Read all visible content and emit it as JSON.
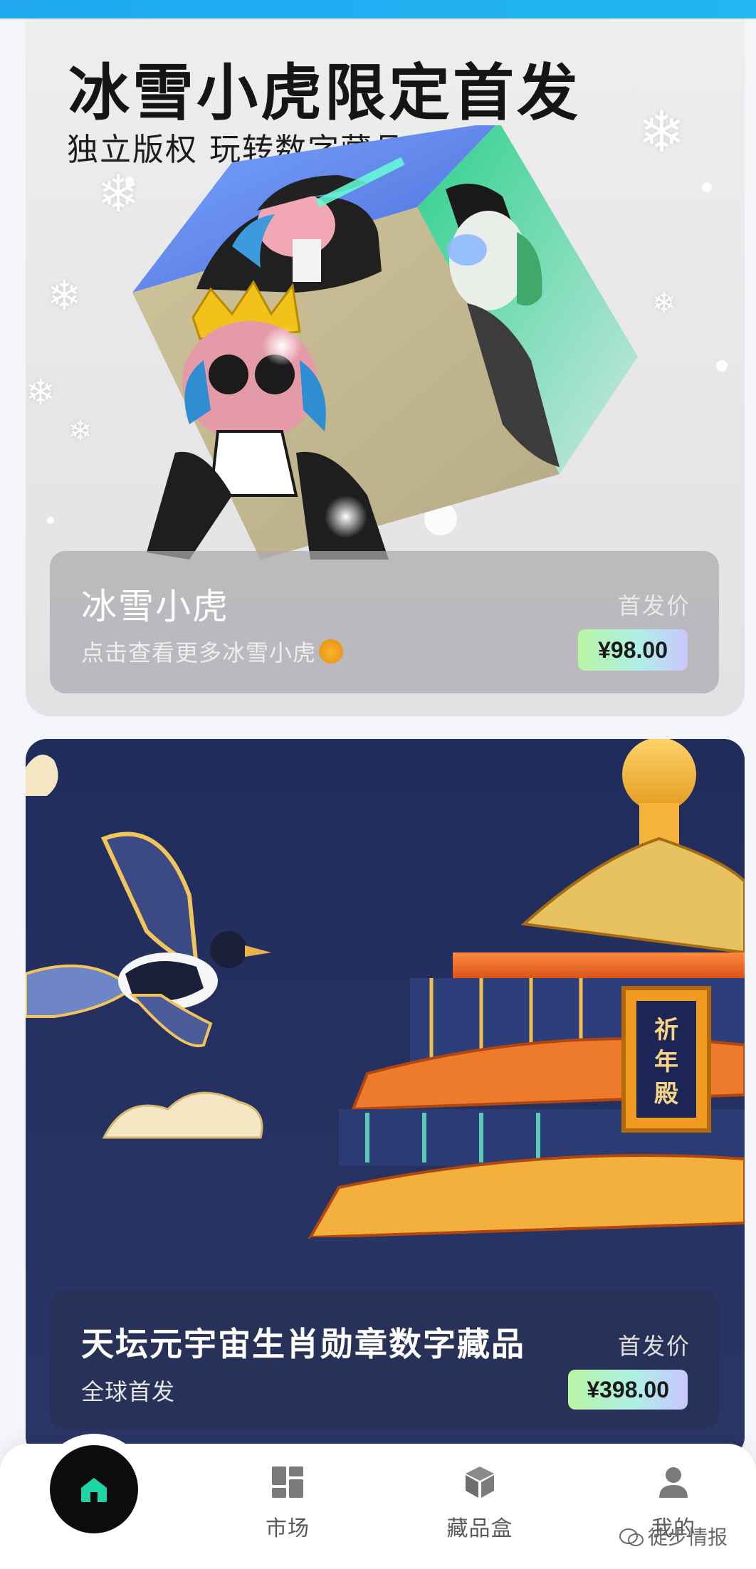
{
  "colors": {
    "status_strip": "#1fa8ee",
    "price_tag_gradient": [
      "#b9f5a4",
      "#aef0e6",
      "#c9c6ff"
    ],
    "home_button": "#0c0c0c",
    "home_icon": "#1fd4a4"
  },
  "banner": {
    "title": "冰雪小虎限定首发",
    "subtitle": "独立版权 玩转数字藏品"
  },
  "products": [
    {
      "name": "冰雪小虎",
      "description": "点击查看更多冰雪小虎",
      "description_emoji_icon": "tiger-face-icon",
      "price_label": "首发价",
      "price": "¥98.00"
    },
    {
      "name": "天坛元宇宙生肖勋章数字藏品",
      "description": "全球首发",
      "price_label": "首发价",
      "price": "¥398.00"
    }
  ],
  "scene": {
    "plaque_text": "祈年殿"
  },
  "nav": {
    "items": [
      {
        "id": "home",
        "label": "",
        "icon": "home-icon",
        "active": true
      },
      {
        "id": "market",
        "label": "市场",
        "icon": "grid-icon"
      },
      {
        "id": "collection",
        "label": "藏品盒",
        "icon": "cube-icon"
      },
      {
        "id": "me",
        "label": "我的",
        "icon": "user-icon"
      }
    ]
  },
  "watermark": {
    "text": "徒步情报",
    "icon": "wechat-icon"
  }
}
